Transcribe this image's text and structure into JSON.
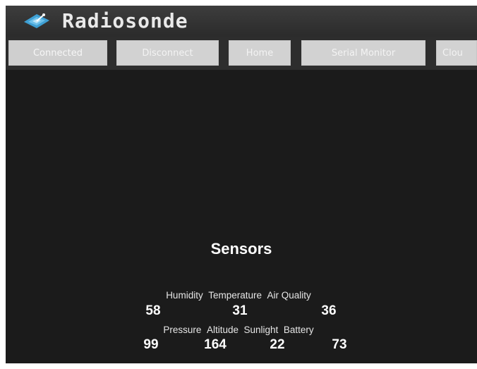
{
  "app": {
    "title": "Radiosonde",
    "logo_icon": "satellite-dish-icon"
  },
  "nav": {
    "connected": "Connected",
    "disconnect": "Disconnect",
    "home": "Home",
    "serial_monitor": "Serial Monitor",
    "cloud": "Clou"
  },
  "sensors": {
    "title": "Sensors",
    "row1_labels": {
      "humidity": "Humidity",
      "temperature": "Temperature",
      "air_quality": "Air Quality"
    },
    "row1_values": {
      "humidity": "58",
      "temperature": "31",
      "air_quality": "36"
    },
    "row2_labels": {
      "pressure": "Pressure",
      "altitude": "Altitude",
      "sunlight": "Sunlight",
      "battery": "Battery"
    },
    "row2_values": {
      "pressure": "99",
      "altitude": "164",
      "sunlight": "22",
      "battery": "73"
    }
  },
  "colors": {
    "background": "#1b1b1b",
    "button": "#d2d2d2",
    "logo": "#4aa8d8"
  }
}
